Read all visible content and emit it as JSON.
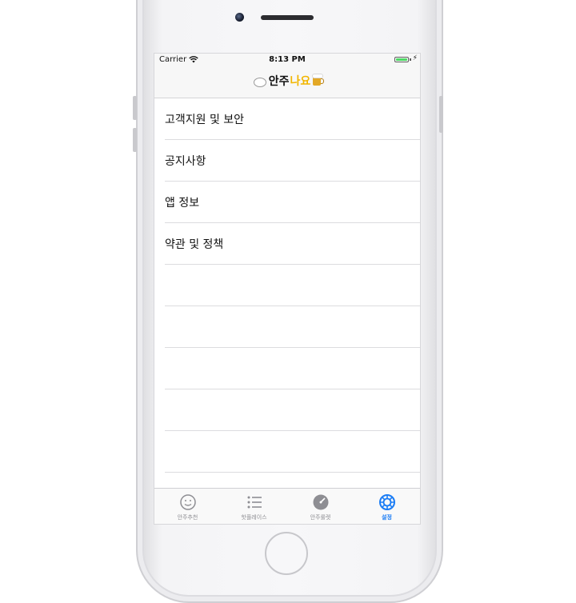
{
  "status_bar": {
    "carrier": "Carrier",
    "time": "8:13 PM"
  },
  "nav": {
    "logo_part1": "안주",
    "logo_part2": "나요"
  },
  "menu": {
    "items": [
      {
        "label": "고객지원 및 보안"
      },
      {
        "label": "공지사항"
      },
      {
        "label": "앱 정보"
      },
      {
        "label": "약관 및 정책"
      }
    ]
  },
  "tabs": [
    {
      "label": "안주추천",
      "icon": "smiley-icon",
      "active": false
    },
    {
      "label": "핫플레이스",
      "icon": "list-icon",
      "active": false
    },
    {
      "label": "안주룰렛",
      "icon": "roulette-icon",
      "active": false
    },
    {
      "label": "설정",
      "icon": "gear-icon",
      "active": true
    }
  ],
  "colors": {
    "accent": "#1a7cf5",
    "logo_yellow": "#f2b600",
    "battery": "#4cd964",
    "inactive": "#8e8e93"
  }
}
